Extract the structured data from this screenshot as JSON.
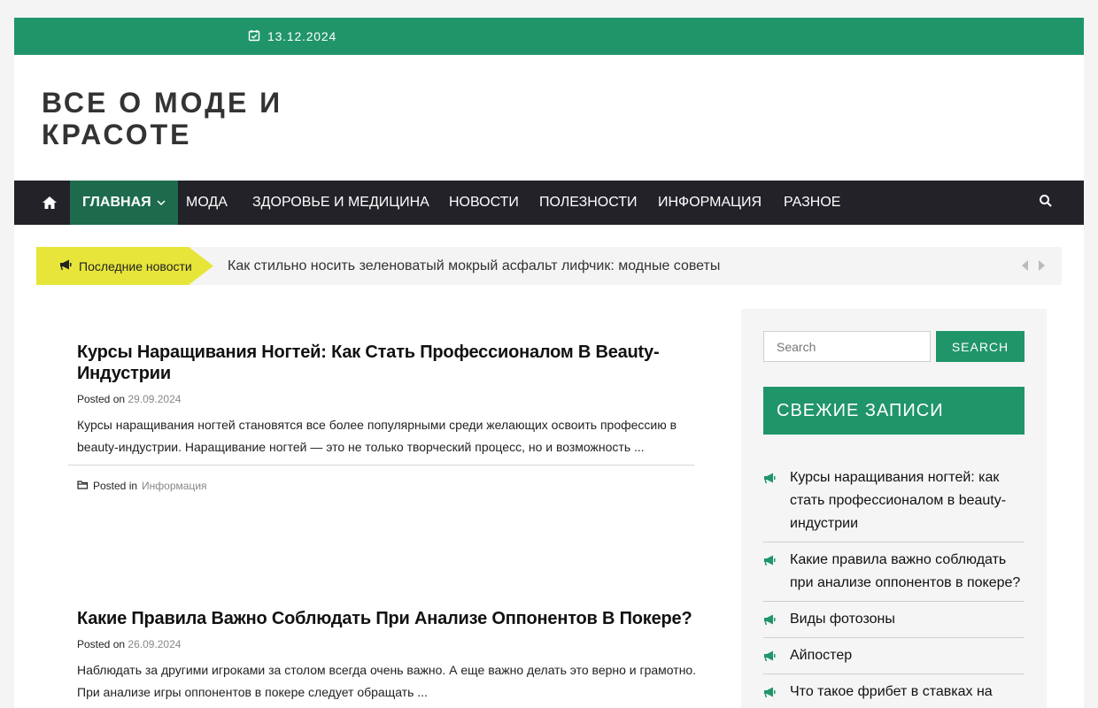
{
  "topbar": {
    "date": "13.12.2024"
  },
  "site": {
    "title": "ВСЕ О МОДЕ И КРАСОТЕ"
  },
  "nav": {
    "items": [
      {
        "label": "ГЛАВНАЯ",
        "active": true
      },
      {
        "label": "МОДА"
      },
      {
        "label": "ЗДОРОВЬЕ И МЕДИЦИНА"
      },
      {
        "label": "НОВОСТИ"
      },
      {
        "label": "ПОЛЕЗНОСТИ"
      },
      {
        "label": "ИНФОРМАЦИЯ"
      },
      {
        "label": "РАЗНОЕ"
      }
    ]
  },
  "ticker": {
    "label": "Последние новости",
    "text": "Как стильно носить зеленоватый мокрый асфальт лифчик: модные советы"
  },
  "posts": [
    {
      "title": "Курсы Наращивания Ногтей: Как Стать Профессионалом В Beauty-Индустрии",
      "posted_on": "Posted on",
      "date": "29.09.2024",
      "excerpt": "  Курсы наращивания ногтей становятся все более популярными среди желающих освоить профессию в beauty-индустрии. Наращивание ногтей — это не только творческий процесс, но и возможность ...",
      "posted_in": "Posted in",
      "category": "Информация"
    },
    {
      "title": "Какие Правила Важно Соблюдать При Анализе Оппонентов В Покере?",
      "posted_on": "Posted on",
      "date": "26.09.2024",
      "excerpt": "Наблюдать за другими игроками за столом всегда очень важно. А еще важно делать это верно и грамотно. При анализе игры оппонентов в покере следует обращать ..."
    }
  ],
  "sidebar": {
    "search_placeholder": "Search",
    "search_button": "SEARCH",
    "widget_title": "СВЕЖИЕ ЗАПИСИ",
    "recent": [
      "Курсы наращивания ногтей: как стать профессионалом в beauty-индустрии",
      "Какие правила важно соблюдать при анализе оппонентов в покере?",
      "Виды фотозоны",
      "Айпостер",
      "Что такое фрибет в ставках на спорт и как его получить"
    ]
  },
  "colors": {
    "accent": "#21956a",
    "nav_bg": "#222228",
    "active_nav": "#1d6b4c",
    "ticker_label": "#e7e53a"
  }
}
